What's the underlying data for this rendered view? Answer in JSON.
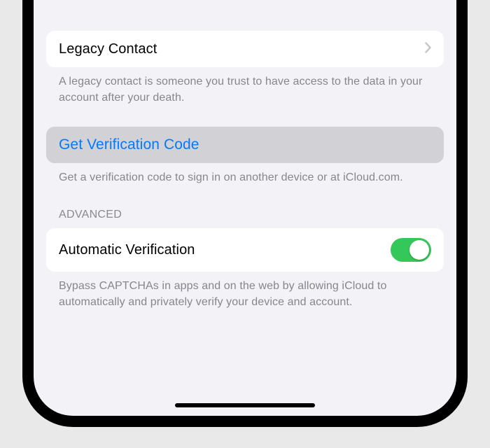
{
  "legacy": {
    "title": "Legacy Contact",
    "footer": "A legacy contact is someone you trust to have access to the data in your account after your death."
  },
  "verification": {
    "title": "Get Verification Code",
    "footer": "Get a verification code to sign in on another device or at iCloud.com."
  },
  "advanced": {
    "header": "ADVANCED",
    "auto_verification_title": "Automatic Verification",
    "auto_verification_on": true,
    "footer": "Bypass CAPTCHAs in apps and on the web by allowing iCloud to automatically and privately verify your device and account."
  },
  "colors": {
    "link": "#007aff",
    "toggle_on": "#34c759",
    "background": "#f2f2f7"
  }
}
